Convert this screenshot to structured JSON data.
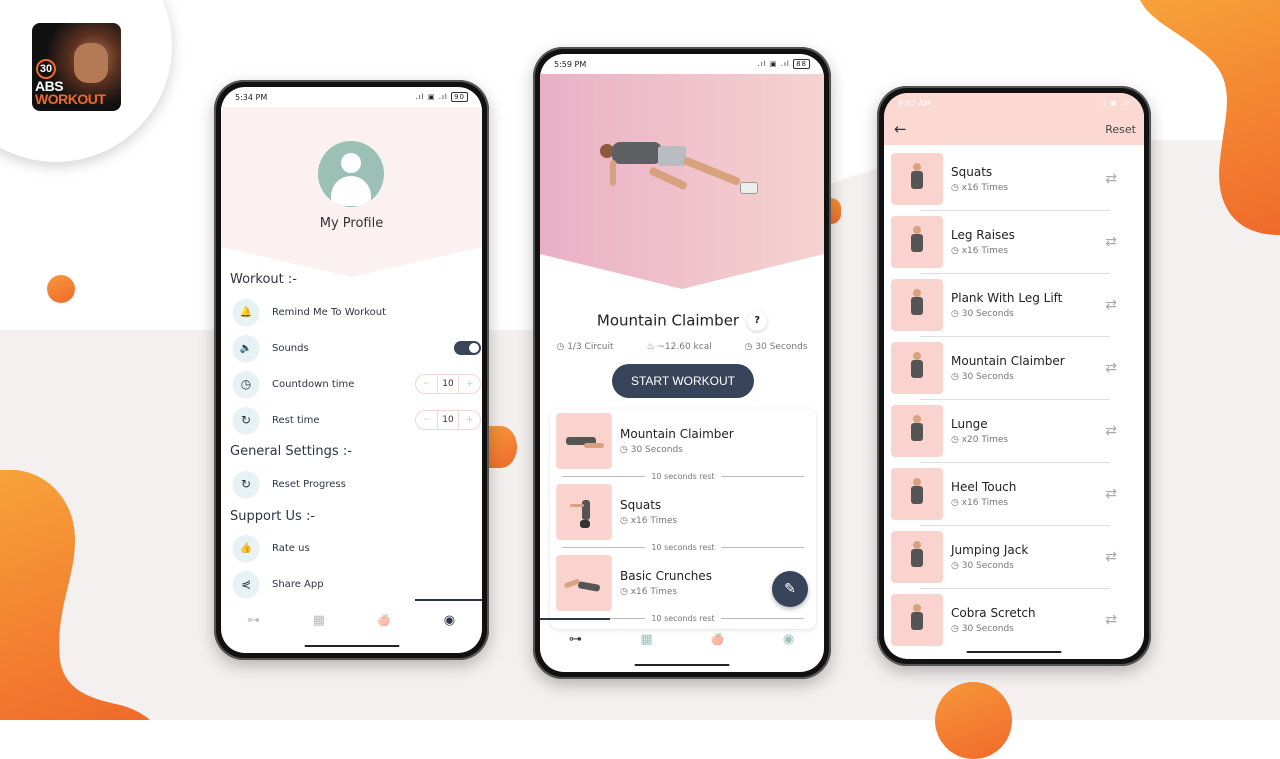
{
  "brand": {
    "logo_number": "30",
    "logo_line1": "ABS",
    "logo_line2": "WORKOUT",
    "accent_color": "#f06a2a",
    "dark_color": "#364358",
    "pink_color": "#fbd3ce"
  },
  "profile_screen": {
    "status_time": "5:34 PM",
    "battery": "90",
    "title": "My Profile",
    "sections": {
      "workout": "Workout :-",
      "general": "General Settings :-",
      "support": "Support Us :-"
    },
    "items": {
      "remind": {
        "label": "Remind Me To Workout",
        "icon": "bell-icon"
      },
      "sounds": {
        "label": "Sounds",
        "icon": "speaker-icon",
        "enabled": true
      },
      "countdown": {
        "label": "Countdown time",
        "icon": "clock-icon",
        "value": "10",
        "minus": "−",
        "plus": "+"
      },
      "rest": {
        "label": "Rest time",
        "icon": "refresh-icon",
        "value": "10",
        "minus": "−",
        "plus": "+"
      },
      "reset": {
        "label": "Reset Progress",
        "icon": "refresh-icon"
      },
      "rate": {
        "label": "Rate us",
        "icon": "thumbs-up-icon"
      },
      "share": {
        "label": "Share App",
        "icon": "share-icon"
      }
    },
    "nav_active": "profile"
  },
  "workout_screen": {
    "status_time": "5:59 PM",
    "battery": "88",
    "exercise_title": "Mountain Claimber",
    "help": "?",
    "meta": {
      "circuit": "1/3 Circuit",
      "kcal": "~12.60 kcal",
      "duration": "30 Seconds"
    },
    "start_label": "START WORKOUT",
    "exercises": [
      {
        "name": "Mountain Claimber",
        "detail": "30 Seconds",
        "rest": "10 seconds rest"
      },
      {
        "name": "Squats",
        "detail": "x16 Times",
        "rest": "10 seconds rest"
      },
      {
        "name": "Basic Crunches",
        "detail": "x16 Times",
        "rest": "10 seconds rest"
      }
    ],
    "nav_active": "workout"
  },
  "replace_screen": {
    "status_time": "9:57 AM",
    "reset_label": "Reset",
    "exercises": [
      {
        "name": "Squats",
        "detail": "x16 Times"
      },
      {
        "name": "Leg Raises",
        "detail": "x16 Times"
      },
      {
        "name": "Plank With Leg Lift",
        "detail": "30 Seconds"
      },
      {
        "name": "Mountain Claimber",
        "detail": "30 Seconds"
      },
      {
        "name": "Lunge",
        "detail": "x20 Times"
      },
      {
        "name": "Heel Touch",
        "detail": "x16 Times"
      },
      {
        "name": "Jumping Jack",
        "detail": "30 Seconds"
      },
      {
        "name": "Cobra Scretch",
        "detail": "30 Seconds"
      }
    ]
  },
  "glyphs": {
    "bell": "🔔",
    "speaker": "🔈",
    "clock": "◷",
    "refresh": "↻",
    "thumb": "👍",
    "share": "⋞",
    "timer": "◷",
    "flame": "♨",
    "back": "←",
    "swap": "⇄",
    "pencil": "✎",
    "dumbbell": "⊶",
    "calc": "▦",
    "food": "🍎",
    "user": "◉",
    "signal": ".ıl ▣ .ıl"
  }
}
